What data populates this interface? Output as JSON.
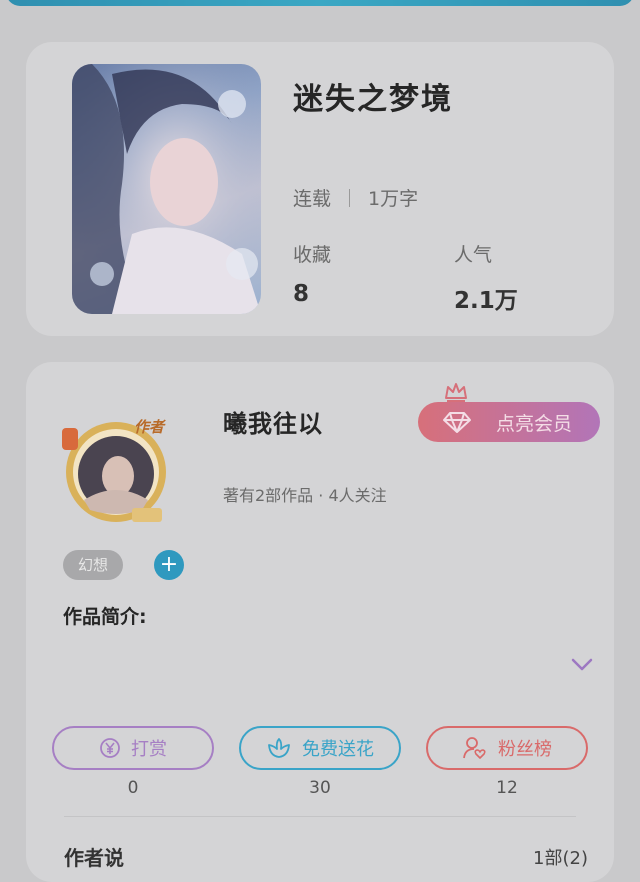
{
  "book": {
    "title": "迷失之梦境",
    "status": "连载",
    "word_count": "1万字",
    "stats": [
      {
        "label": "收藏",
        "value": "8"
      },
      {
        "label": "人气",
        "value": "2.1万"
      }
    ]
  },
  "author": {
    "name": "曦我往以",
    "summary": "著有2部作品 · 4人关注",
    "avatar_badge": "作者",
    "vip_label": "点亮会员",
    "tag": "幻想",
    "add_label": "+",
    "intro_label": "作品简介:"
  },
  "actions": [
    {
      "label": "打赏",
      "count": "0",
      "color": "#a67fc4",
      "icon": "yuan-coin-icon"
    },
    {
      "label": "免费送花",
      "count": "30",
      "color": "#3aa4c8",
      "icon": "flower-icon"
    },
    {
      "label": "粉丝榜",
      "count": "12",
      "color": "#d96a6a",
      "icon": "user-heart-icon"
    }
  ],
  "bottom": {
    "title": "作者说",
    "right_text": "1部(2)"
  }
}
